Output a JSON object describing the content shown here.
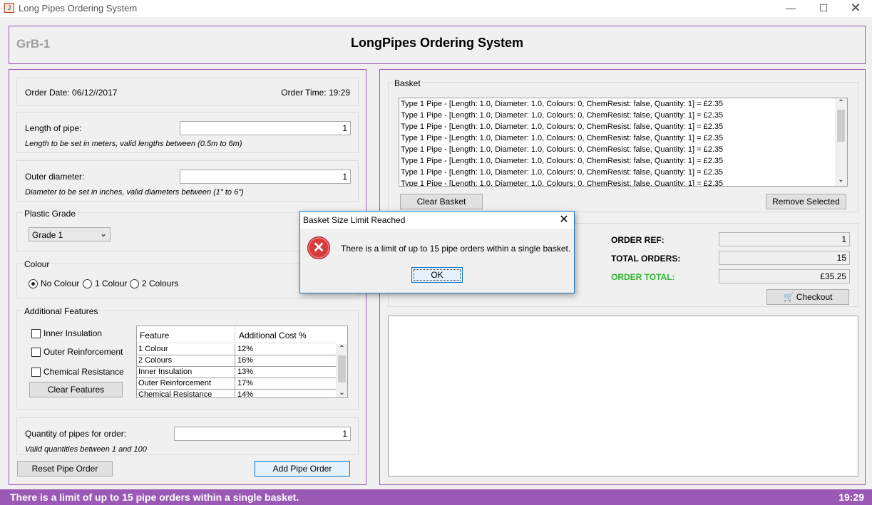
{
  "window": {
    "title": "Long Pipes Ordering System",
    "icon_text": "J"
  },
  "header": {
    "group_id": "GrB-1",
    "title": "LongPipes Ordering System"
  },
  "order_info": {
    "date": "Order Date: 06/12//2017",
    "time": "Order Time: 19:29"
  },
  "length": {
    "label": "Length of pipe:",
    "value": "1",
    "hint": "Length to be set in meters, valid lengths between (0.5m to 6m)"
  },
  "diameter": {
    "label": "Outer diameter:",
    "value": "1",
    "hint": "Diameter to be set in inches, valid diameters between  (1\" to 6\")"
  },
  "plastic_grade": {
    "title": "Plastic Grade",
    "selected": "Grade 1"
  },
  "colour": {
    "title": "Colour",
    "options": [
      "No Colour",
      "1 Colour",
      "2 Colours"
    ],
    "selected": "No Colour"
  },
  "features": {
    "title": "Additional Features",
    "checkboxes": [
      "Inner Insulation",
      "Outer Reinforcement",
      "Chemical Resistance"
    ],
    "clear_label": "Clear Features",
    "table": {
      "headers": [
        "Feature",
        "Additional Cost %"
      ],
      "rows": [
        [
          "1 Colour",
          "12%"
        ],
        [
          "2 Colours",
          "16%"
        ],
        [
          "Inner Insulation",
          "13%"
        ],
        [
          "Outer Reinforcement",
          "17%"
        ],
        [
          "Chemical Resistance",
          "14%"
        ]
      ]
    }
  },
  "quantity": {
    "label": "Quantity of pipes for order:",
    "value": "1",
    "hint": "Valid quantities between 1 and 100"
  },
  "buttons": {
    "reset": "Reset Pipe Order",
    "add": "Add Pipe Order"
  },
  "basket": {
    "title": "Basket",
    "items": [
      "Type 1 Pipe - [Length: 1.0, Diameter: 1.0, Colours: 0, ChemResist: false, Quantity: 1] = £2.35",
      "Type 1 Pipe - [Length: 1.0, Diameter: 1.0, Colours: 0, ChemResist: false, Quantity: 1] = £2.35",
      "Type 1 Pipe - [Length: 1.0, Diameter: 1.0, Colours: 0, ChemResist: false, Quantity: 1] = £2.35",
      "Type 1 Pipe - [Length: 1.0, Diameter: 1.0, Colours: 0, ChemResist: false, Quantity: 1] = £2.35",
      "Type 1 Pipe - [Length: 1.0, Diameter: 1.0, Colours: 0, ChemResist: false, Quantity: 1] = £2.35",
      "Type 1 Pipe - [Length: 1.0, Diameter: 1.0, Colours: 0, ChemResist: false, Quantity: 1] = £2.35",
      "Type 1 Pipe - [Length: 1.0, Diameter: 1.0, Colours: 0, ChemResist: false, Quantity: 1] = £2.35",
      "Type 1 Pipe - [Length: 1.0, Diameter: 1.0, Colours: 0, ChemResist: false, Quantity: 1] = £2.35"
    ],
    "clear_label": "Clear Basket",
    "remove_label": "Remove Selected"
  },
  "summary": {
    "ref_label": "ORDER REF:",
    "ref_value": "1",
    "orders_label": "TOTAL ORDERS:",
    "orders_value": "15",
    "total_label": "ORDER TOTAL:",
    "total_value": "£35.25",
    "checkout_label": "Checkout"
  },
  "dialog": {
    "title": "Basket Size Limit Reached",
    "message": "There is a limit of up to 15 pipe orders within a single basket.",
    "ok_label": "OK"
  },
  "status": {
    "message": "There is a limit of up to 15 pipe orders within a single basket.",
    "time": "19:29"
  },
  "colors": {
    "accent": "#9b59b6",
    "total_green": "#2eb82e",
    "error_red": "#c0392b"
  }
}
